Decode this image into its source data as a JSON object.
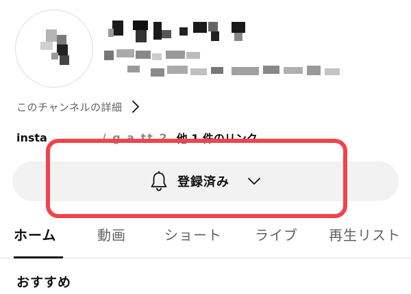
{
  "channel": {
    "about_label": "このチャンネルの詳細",
    "links_prefix": "insta",
    "links_middle": "/ g a  tt  2",
    "links_suffix": "他 1 件のリンク"
  },
  "subscribe": {
    "label": "登録済み",
    "bell_icon": "bell-icon",
    "chevron_icon": "chevron-down-icon"
  },
  "tabs": [
    {
      "label": "ホーム",
      "active": true
    },
    {
      "label": "動画",
      "active": false
    },
    {
      "label": "ショート",
      "active": false
    },
    {
      "label": "ライブ",
      "active": false
    },
    {
      "label": "再生リスト",
      "active": false
    }
  ],
  "section": {
    "title": "おすすめ"
  },
  "colors": {
    "highlight": "#f2424b",
    "pill_bg": "#f2f2f2",
    "text_primary": "#0f0f0f",
    "text_secondary": "#606060"
  }
}
